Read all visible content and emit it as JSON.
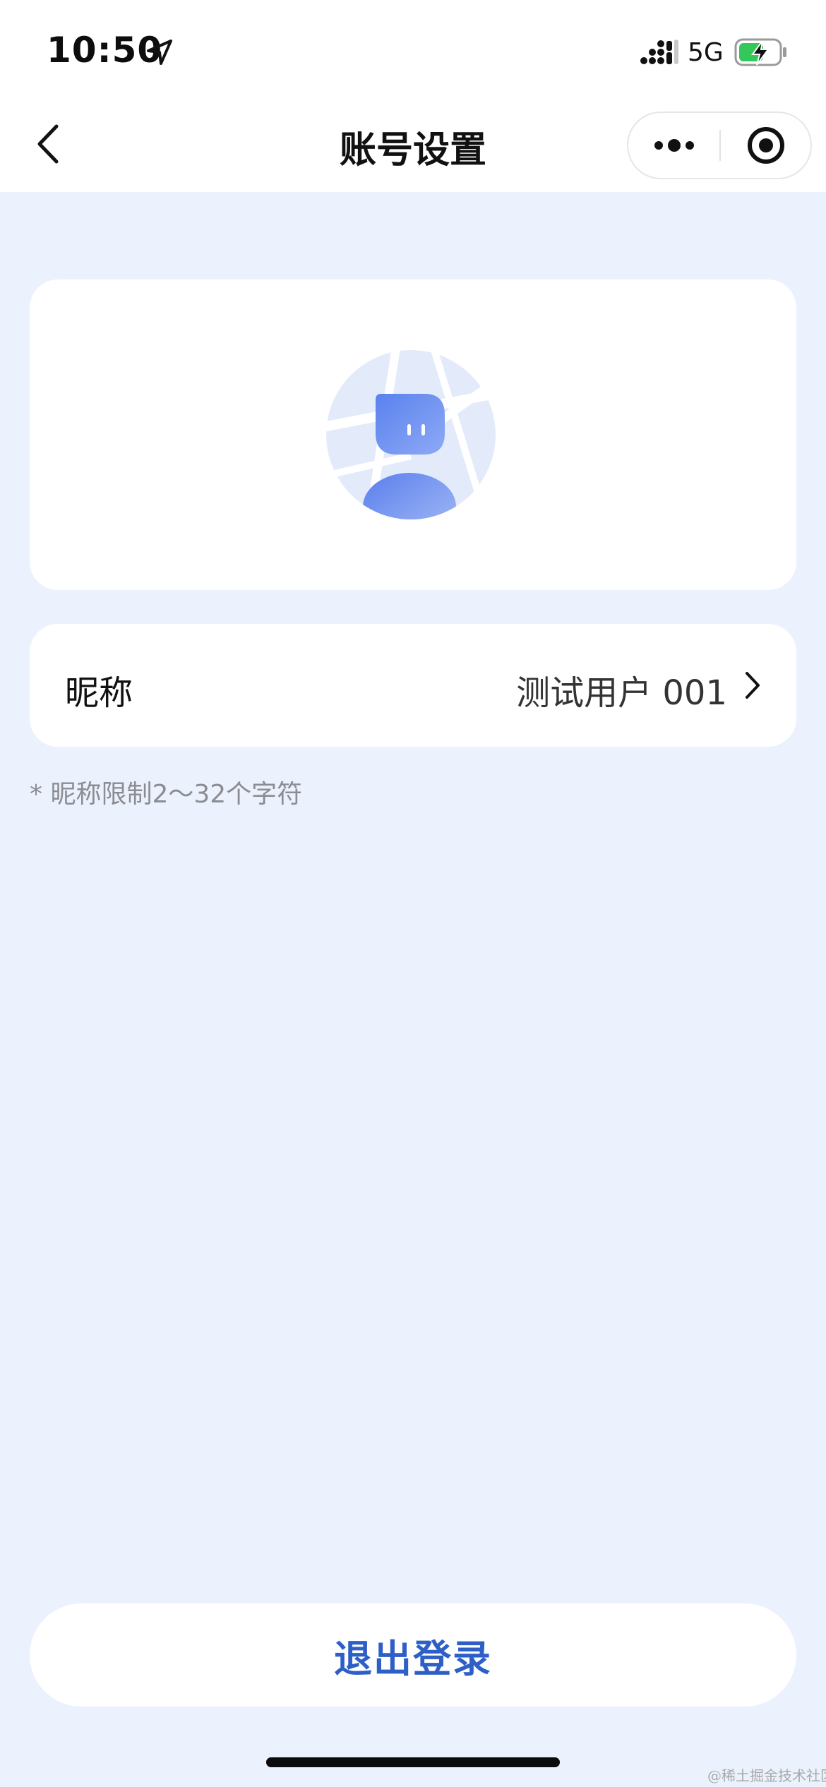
{
  "status_bar": {
    "time": "10:50",
    "network": "5G",
    "icons": [
      "location-arrow-icon",
      "signal-icon",
      "battery-charging-icon"
    ]
  },
  "nav": {
    "title": "账号设置",
    "back_icon": "chevron-left-icon",
    "more_icon": "more-dots-icon",
    "close_icon": "target-close-icon"
  },
  "profile": {
    "avatar_icon": "robot-avatar-icon",
    "nickname_label": "昵称",
    "nickname_value": "测试用户 001",
    "hint": "* 昵称限制2～32个字符"
  },
  "actions": {
    "logout_label": "退出登录"
  },
  "watermark": "@稀土掘金技术社区",
  "colors": {
    "page_background": "#EBF2FD",
    "card_background": "#FFFFFF",
    "accent": "#2E5FC7",
    "avatar_blue": "#6B8EF0",
    "battery_green": "#34C759"
  }
}
